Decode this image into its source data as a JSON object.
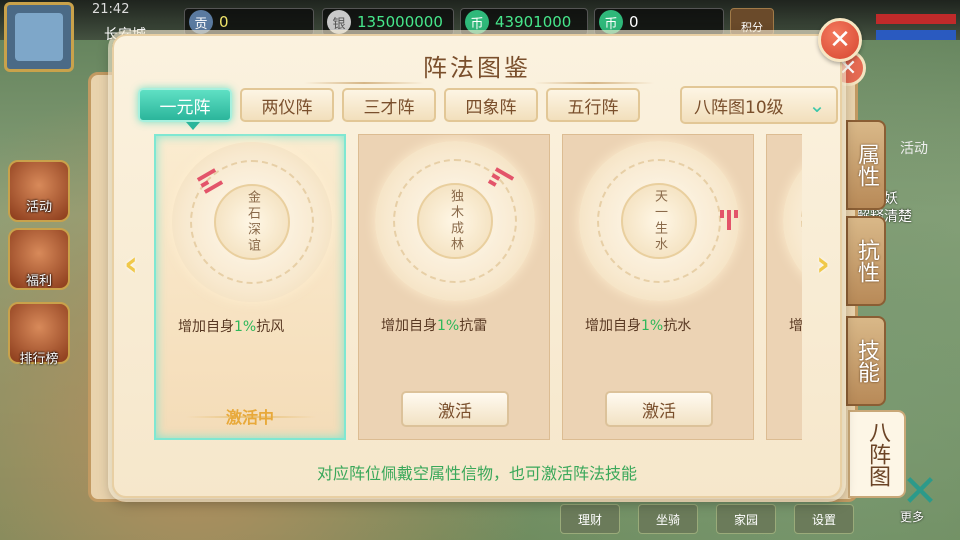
{
  "hud": {
    "time": "21:42",
    "city": "长安城",
    "currencies": [
      {
        "icon": "tribute-coin-icon",
        "glyph": "贡",
        "value": "0",
        "style": "yellow"
      },
      {
        "icon": "silver-ingot-icon",
        "glyph": "银",
        "value": "135000000",
        "style": "green"
      },
      {
        "icon": "jade-coin-icon",
        "glyph": "币",
        "value": "43901000",
        "style": "green"
      },
      {
        "icon": "jade-coin-bound-icon",
        "glyph": "币",
        "value": "0",
        "style": "white"
      }
    ],
    "jifen_label": "积分",
    "activity_label": "活动",
    "chat_text": "我是妖\n解释清楚"
  },
  "left_menu": [
    {
      "label": "活动"
    },
    {
      "label": "福利"
    },
    {
      "label": "排行榜"
    }
  ],
  "bottom_buttons": [
    "理财",
    "坐骑",
    "家园",
    "设置"
  ],
  "more_label": "更多",
  "dialog": {
    "title": "阵法图鉴",
    "close_glyph": "✕",
    "tabs": [
      {
        "label": "一元阵",
        "active": true
      },
      {
        "label": "两仪阵",
        "active": false
      },
      {
        "label": "三才阵",
        "active": false
      },
      {
        "label": "四象阵",
        "active": false
      },
      {
        "label": "五行阵",
        "active": false
      }
    ],
    "dropdown": {
      "label": "八阵图10级",
      "chevron": "⌄"
    },
    "prev_arrow": "‹",
    "next_arrow": "›",
    "cards": [
      {
        "center": "金石深谊",
        "desc_prefix": "增加自身",
        "pct": "1%",
        "desc_suffix": "抗风",
        "state": "active",
        "status_label": "激活中",
        "trigram": [
          1,
          0,
          1
        ],
        "trigram_color": "red",
        "trigram_pos": "left"
      },
      {
        "center": "独木成林",
        "desc_prefix": "增加自身",
        "pct": "1%",
        "desc_suffix": "抗雷",
        "state": "inactive",
        "button_label": "激活",
        "trigram": [
          1,
          0,
          0
        ],
        "trigram_color": "red",
        "trigram_pos": "right"
      },
      {
        "center": "天一生水",
        "desc_prefix": "增加自身",
        "pct": "1%",
        "desc_suffix": "抗水",
        "state": "inactive",
        "button_label": "激活",
        "trigram": [
          0,
          1,
          0
        ],
        "trigram_color": "red",
        "trigram_pos": "right-vertical"
      },
      {
        "center": "",
        "desc_prefix": "增",
        "pct": "",
        "desc_suffix": "",
        "state": "partial",
        "trigram": [
          1,
          1,
          1
        ],
        "trigram_color": "teal",
        "trigram_pos": "left-vertical"
      }
    ],
    "footer": "对应阵位佩戴空属性信物，也可激活阵法技能"
  },
  "right_tabs": [
    {
      "label": "属性",
      "active": false
    },
    {
      "label": "抗性",
      "active": false
    },
    {
      "label": "技能",
      "active": false
    },
    {
      "label": "八阵图",
      "active": true
    }
  ]
}
